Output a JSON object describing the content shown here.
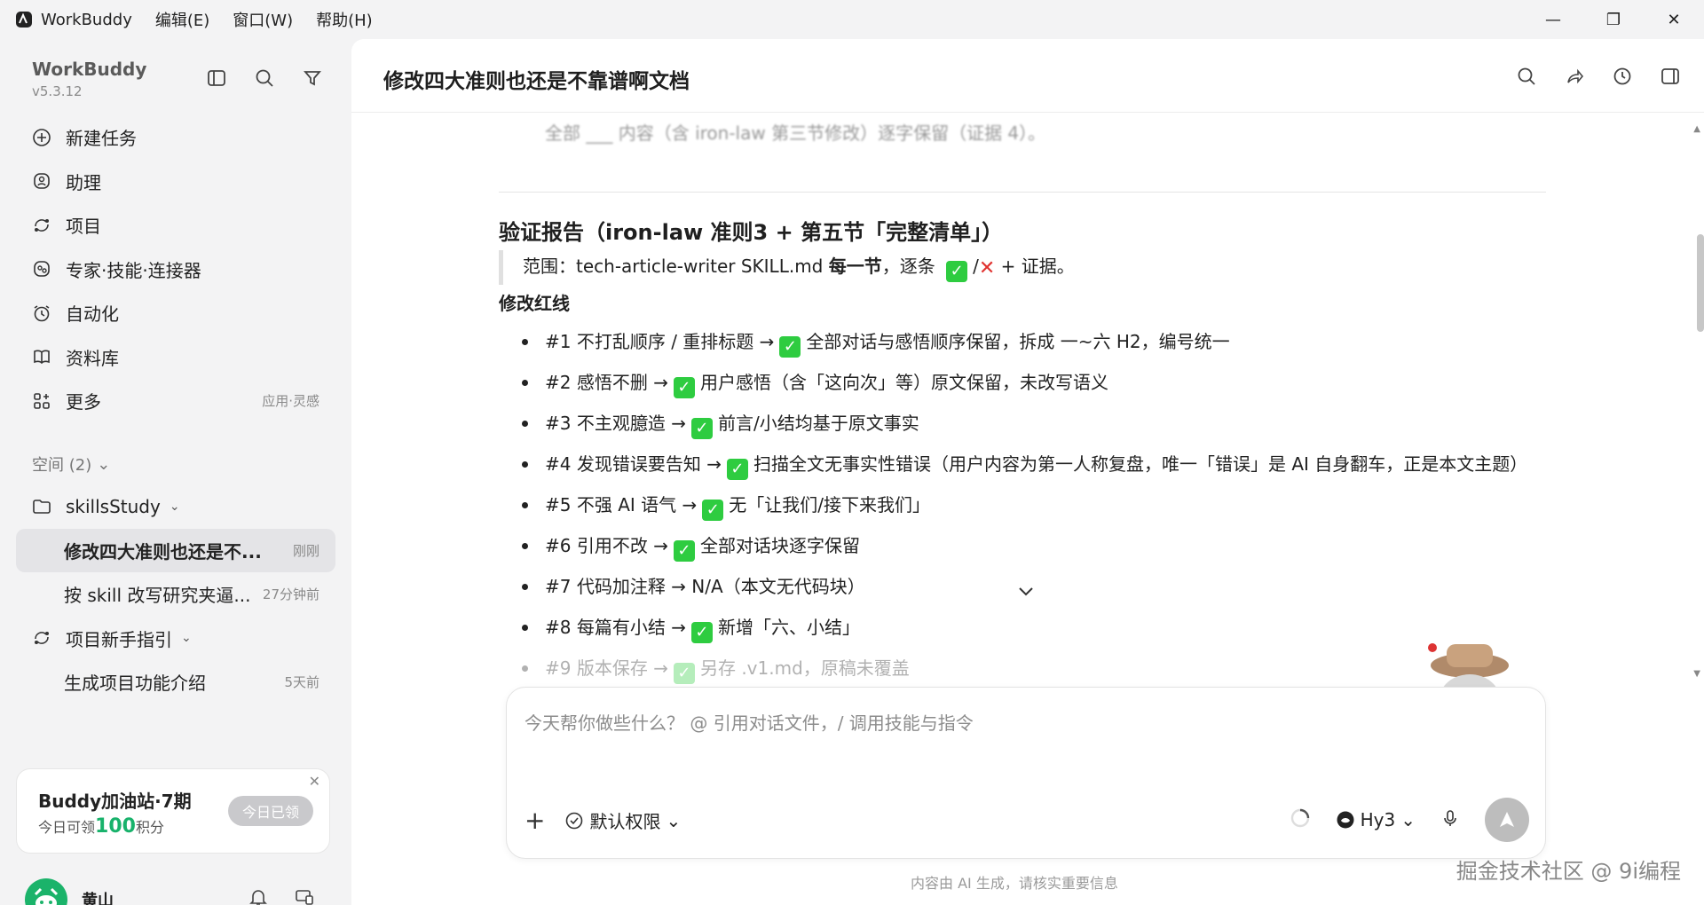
{
  "titlebar": {
    "app_name": "WorkBuddy",
    "menus": [
      "编辑(E)",
      "窗口(W)",
      "帮助(H)"
    ],
    "controls": [
      "—",
      "❐",
      "✕"
    ]
  },
  "sidebar": {
    "brand": "WorkBuddy",
    "version": "v5.3.12",
    "nav": [
      {
        "label": "新建任务",
        "icon": "plus-circle-icon"
      },
      {
        "label": "助理",
        "icon": "assistant-icon"
      },
      {
        "label": "项目",
        "icon": "project-icon"
      },
      {
        "label": "专家·技能·连接器",
        "icon": "expert-icon"
      },
      {
        "label": "自动化",
        "icon": "alarm-icon"
      },
      {
        "label": "资料库",
        "icon": "book-icon"
      },
      {
        "label": "更多",
        "icon": "grid-icon",
        "extra": "应用·灵感"
      }
    ],
    "space_header": "空间 (2)",
    "tree": [
      {
        "label": "skillsStudy",
        "type": "folder",
        "time": ""
      },
      {
        "label": "修改四大准则也还是不...",
        "type": "child",
        "time": "刚刚",
        "active": true
      },
      {
        "label": "按 skill 改写研究夹逼...",
        "type": "child",
        "time": "27分钟前"
      },
      {
        "label": "项目新手指引",
        "type": "folder",
        "time": ""
      },
      {
        "label": "生成项目功能介绍",
        "type": "child",
        "time": "5天前"
      }
    ],
    "promo": {
      "title": "Buddy加油站·7期",
      "sub_prefix": "今日可领",
      "sub_amount": "100",
      "sub_suffix": "积分",
      "button": "今日已领"
    },
    "user": {
      "name": "黄山"
    }
  },
  "main": {
    "title": "修改四大准则也还是不靠谱啊文档",
    "cut_text": "全部 ___ 内容（含 iron-law 第三节修改）逐字保留（证据 4）。",
    "heading": "验证报告（iron-law 准则3 + 第五节「完整清单」）",
    "quote_prefix": "范围：tech-article-writer SKILL.md ",
    "quote_bold": "每一节",
    "quote_mid": "，逐条 ",
    "quote_slash": "/",
    "quote_suffix": " + 证据。",
    "section": "修改红线",
    "items": [
      {
        "pre": "#1 不打乱顺序 / 重排标题 →",
        "check": true,
        "post": "全部对话与感悟顺序保留，拆成 一~六 H2，编号统一"
      },
      {
        "pre": "#2 感悟不删 →",
        "check": true,
        "post": "用户感悟（含「这向次」等）原文保留，未改写语义"
      },
      {
        "pre": "#3 不主观臆造 →",
        "check": true,
        "post": "前言/小结均基于原文事实"
      },
      {
        "pre": "#4 发现错误要告知 →",
        "check": true,
        "post": "扫描全文无事实性错误（用户内容为第一人称复盘，唯一「错误」是 AI 自身翻车，正是本文主题）"
      },
      {
        "pre": "#5 不强 AI 语气 →",
        "check": true,
        "post": "无「让我们/接下来我们」"
      },
      {
        "pre": "#6 引用不改 →",
        "check": true,
        "post": "全部对话块逐字保留"
      },
      {
        "pre": "#7 代码加注释 → N/A（本文无代码块）",
        "check": false,
        "post": ""
      },
      {
        "pre": "#8 每篇有小结 →",
        "check": true,
        "post": "新增「六、小结」"
      },
      {
        "pre": "#9 版本保存 →",
        "check": true,
        "post": "另存 .v1.md，原稿未覆盖"
      }
    ]
  },
  "composer": {
    "placeholder": "今天帮你做些什么？ @ 引用对话文件，/ 调用技能与指令",
    "add": "+",
    "permission": "默认权限",
    "model": "Hy3"
  },
  "footer": {
    "disclaimer": "内容由 AI 生成，请核实重要信息",
    "watermark": "掘金技术社区 @ 9i编程"
  },
  "colors": {
    "accent_green": "#2ecc40",
    "promo_green": "#18b26b",
    "active_bg": "#e4e4e7"
  }
}
